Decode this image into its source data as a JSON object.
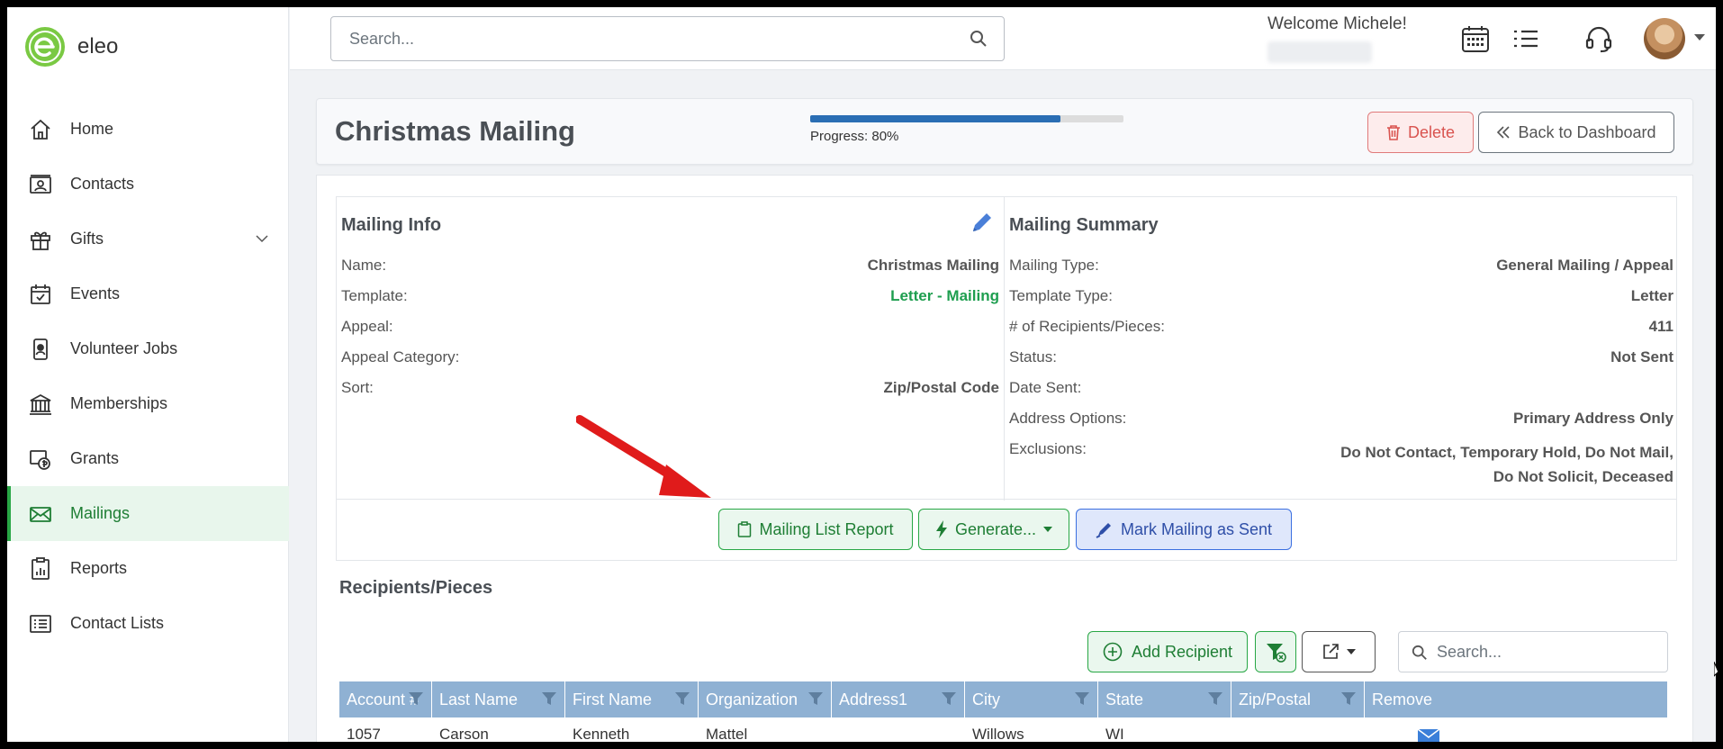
{
  "brand": {
    "name": "eleo"
  },
  "sidebar": {
    "items": [
      {
        "label": "Home",
        "icon": "home-icon"
      },
      {
        "label": "Contacts",
        "icon": "contact-card-icon"
      },
      {
        "label": "Gifts",
        "icon": "gift-icon",
        "expandable": true
      },
      {
        "label": "Events",
        "icon": "calendar-check-icon"
      },
      {
        "label": "Volunteer Jobs",
        "icon": "badge-icon"
      },
      {
        "label": "Memberships",
        "icon": "building-icon"
      },
      {
        "label": "Grants",
        "icon": "grant-icon"
      },
      {
        "label": "Mailings",
        "icon": "envelope-icon",
        "active": true
      },
      {
        "label": "Reports",
        "icon": "report-icon"
      },
      {
        "label": "Contact Lists",
        "icon": "list-icon"
      }
    ]
  },
  "topbar": {
    "search_placeholder": "Search...",
    "welcome": "Welcome Michele!"
  },
  "header": {
    "title": "Christmas Mailing",
    "progress_label": "Progress: 80%",
    "progress_value": 80,
    "delete_label": "Delete",
    "back_label": "Back to Dashboard"
  },
  "mailing_info": {
    "title": "Mailing Info",
    "rows": [
      {
        "label": "Name:",
        "value": "Christmas Mailing"
      },
      {
        "label": "Template:",
        "value": "Letter - Mailing"
      },
      {
        "label": "Appeal:",
        "value": ""
      },
      {
        "label": "Appeal Category:",
        "value": ""
      },
      {
        "label": "Sort:",
        "value": "Zip/Postal Code"
      }
    ]
  },
  "mailing_summary": {
    "title": "Mailing Summary",
    "rows": [
      {
        "label": "Mailing Type:",
        "value": "General Mailing / Appeal"
      },
      {
        "label": "Template Type:",
        "value": "Letter"
      },
      {
        "label": "# of Recipients/Pieces:",
        "value": "411"
      },
      {
        "label": "Status:",
        "value": "Not Sent"
      },
      {
        "label": "Date Sent:",
        "value": ""
      },
      {
        "label": "Address Options:",
        "value": "Primary Address Only"
      },
      {
        "label": "Exclusions:",
        "value": "Do Not Contact, Temporary Hold, Do Not Mail,",
        "value2": "Do Not Solicit, Deceased"
      }
    ]
  },
  "actions": {
    "report_label": "Mailing List Report",
    "generate_label": "Generate...",
    "mark_sent_label": "Mark Mailing as Sent"
  },
  "recipients": {
    "title": "Recipients/Pieces",
    "add_label": "Add Recipient",
    "search_placeholder": "Search...",
    "columns": [
      "Account #",
      "Last Name",
      "First Name",
      "Organization",
      "Address1",
      "City",
      "State",
      "Zip/Postal",
      "Remove"
    ],
    "rows": [
      {
        "account": "1057",
        "last": "Carson",
        "first": "Kenneth",
        "org": "Mattel",
        "address1": "",
        "city": "Willows",
        "state": "WI",
        "zip": ""
      }
    ]
  },
  "colors": {
    "accent_green": "#28a745",
    "header_blue": "#8fb1d3",
    "progress_blue": "#2a6eb4",
    "arrow_red": "#e01b1b"
  }
}
